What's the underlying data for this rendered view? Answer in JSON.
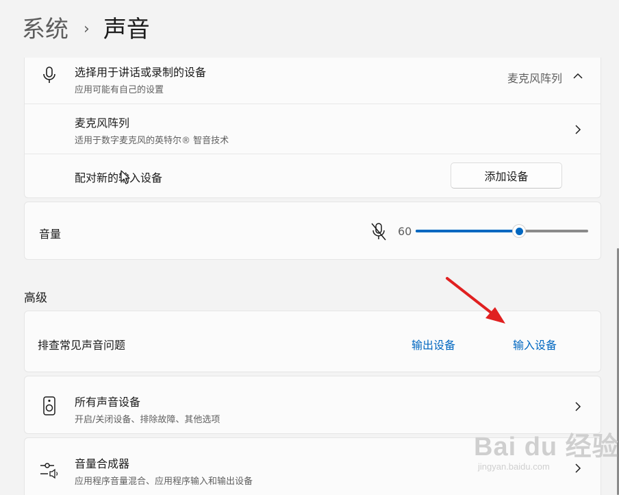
{
  "breadcrumb": {
    "parent": "系统",
    "separator": "›",
    "current": "声音"
  },
  "input_device": {
    "title": "选择用于讲话或录制的设备",
    "subtitle": "应用可能有自己的设置",
    "selected_value": "麦克风阵列",
    "icon": "microphone-icon",
    "expanded_icon": "chevron-up-icon"
  },
  "mic_array": {
    "title": "麦克风阵列",
    "subtitle": "适用于数字麦克风的英特尔® 智音技术",
    "icon": "chevron-right-icon"
  },
  "pair_device": {
    "label": "配对新的输入设备",
    "button_label": "添加设备"
  },
  "volume": {
    "label": "音量",
    "value_text": "60",
    "level_percent": 60,
    "mute_icon": "microphone-muted-icon"
  },
  "advanced": {
    "section_label": "高级",
    "troubleshoot_label": "排查常见声音问题",
    "output_link": "输出设备",
    "input_link": "输入设备"
  },
  "all_devices": {
    "title": "所有声音设备",
    "subtitle": "开启/关闭设备、排除故障、其他选项",
    "icon": "speaker-icon"
  },
  "mixer": {
    "title": "音量合成器",
    "subtitle": "应用程序音量混合、应用程序输入和输出设备",
    "icon": "mixer-icon"
  },
  "watermark": {
    "logo": "Bai du 经验",
    "url": "jingyan.baidu.com"
  },
  "colors": {
    "accent": "#0067c0",
    "arrow": "#e02020",
    "background": "#f3f3f3",
    "card": "#fbfbfb"
  }
}
